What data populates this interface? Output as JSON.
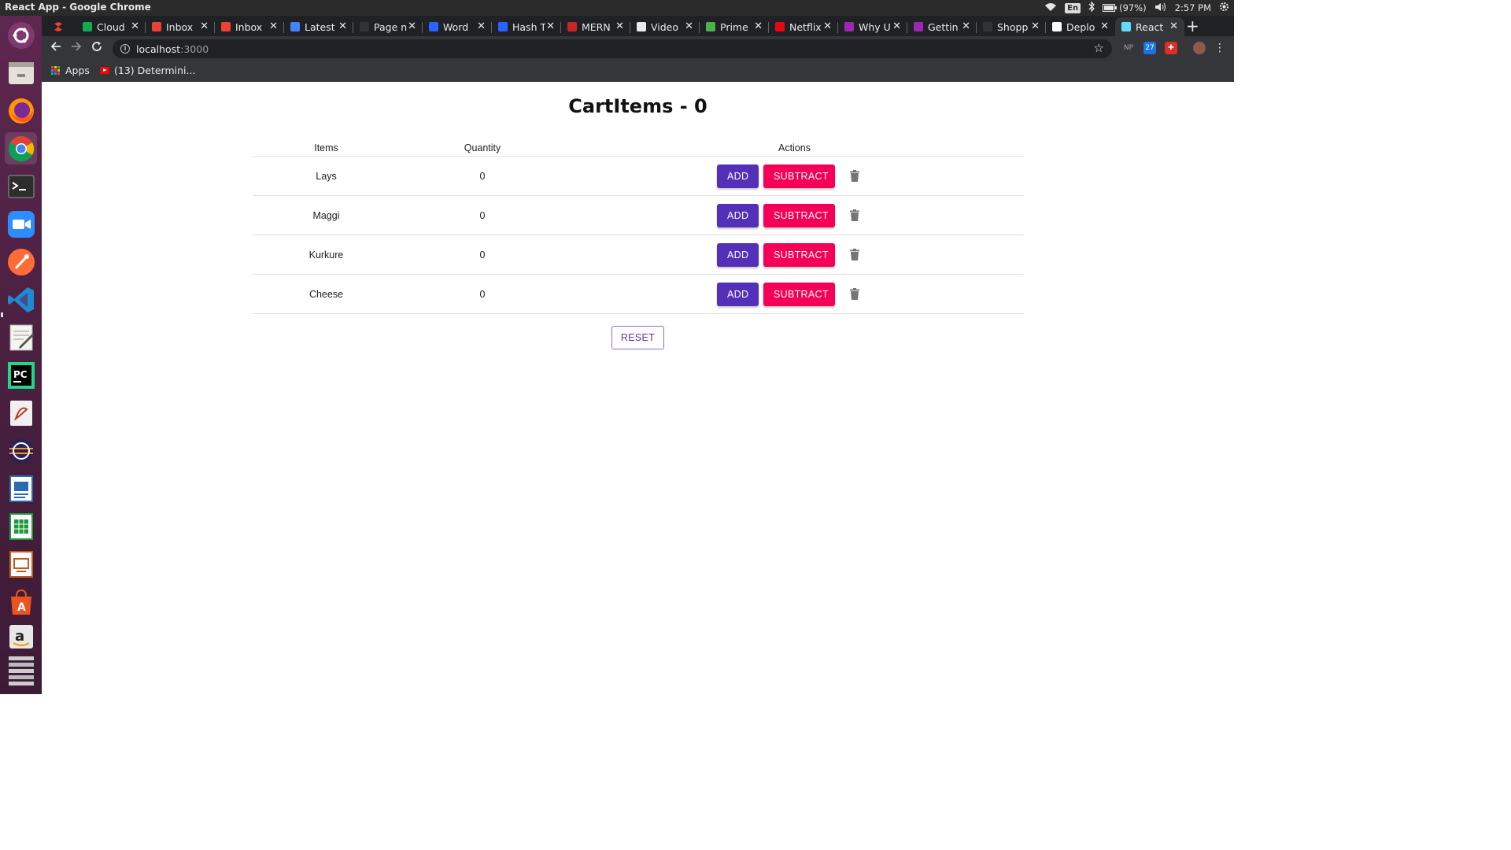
{
  "os": {
    "window_title": "React App - Google Chrome",
    "lang": "En",
    "battery": "(97%)",
    "time": "2:57 PM"
  },
  "launcher": {
    "items": [
      "ubuntu-software-center",
      "files",
      "firefox",
      "chrome",
      "terminal",
      "zoom",
      "postman",
      "vscode",
      "text-editor",
      "pycharm",
      "document-viewer",
      "eclipse",
      "writer",
      "calc",
      "impress",
      "software-store",
      "amazon",
      "stacked-apps"
    ]
  },
  "browser": {
    "tabs": [
      {
        "label": "Cloud",
        "icon": "mongodb-leaf-icon",
        "color": "#13aa52"
      },
      {
        "label": "Inbox",
        "icon": "gmail-icon",
        "color": "#ea4335"
      },
      {
        "label": "Inbox",
        "icon": "gmail-icon",
        "color": "#ea4335"
      },
      {
        "label": "Latest",
        "icon": "docs-icon",
        "color": "#4285f4"
      },
      {
        "label": "Page n",
        "icon": "github-icon",
        "color": "#333333"
      },
      {
        "label": "Word",
        "icon": "hashnode-icon",
        "color": "#2962ff"
      },
      {
        "label": "Hash T",
        "icon": "hashnode-icon",
        "color": "#2962ff"
      },
      {
        "label": "MERN",
        "icon": "mern-icon",
        "color": "#c62828"
      },
      {
        "label": "Video",
        "icon": "video-icon",
        "color": "#e8eaed"
      },
      {
        "label": "Prime",
        "icon": "prime-icon",
        "color": "#4caf50"
      },
      {
        "label": "Netflix",
        "icon": "netflix-icon",
        "color": "#e50914"
      },
      {
        "label": "Why U",
        "icon": "graphql-icon",
        "color": "#9c27b0"
      },
      {
        "label": "Gettin",
        "icon": "graphql-icon",
        "color": "#9c27b0"
      },
      {
        "label": "Shopp",
        "icon": "github-icon",
        "color": "#333333"
      },
      {
        "label": "Deplo",
        "icon": "medium-icon",
        "color": "#ffffff"
      },
      {
        "label": "React",
        "icon": "react-icon",
        "color": "#61dafb"
      }
    ],
    "url_host": "localhost",
    "url_port": ":3000",
    "extensions": [
      "NP",
      "27"
    ],
    "bookmarks": {
      "apps_label": "Apps",
      "item_label": "(13) Determini..."
    }
  },
  "app": {
    "title": "CartItems - 0",
    "columns": {
      "items": "Items",
      "quantity": "Quantity",
      "actions": "Actions"
    },
    "rows": [
      {
        "name": "Lays",
        "quantity": "0"
      },
      {
        "name": "Maggi",
        "quantity": "0"
      },
      {
        "name": "Kurkure",
        "quantity": "0"
      },
      {
        "name": "Cheese",
        "quantity": "0"
      }
    ],
    "add_label": "ADD",
    "subtract_label": "SUBTRACT",
    "reset_label": "RESET",
    "colors": {
      "add": "#5430b8",
      "subtract": "#f50057"
    }
  }
}
